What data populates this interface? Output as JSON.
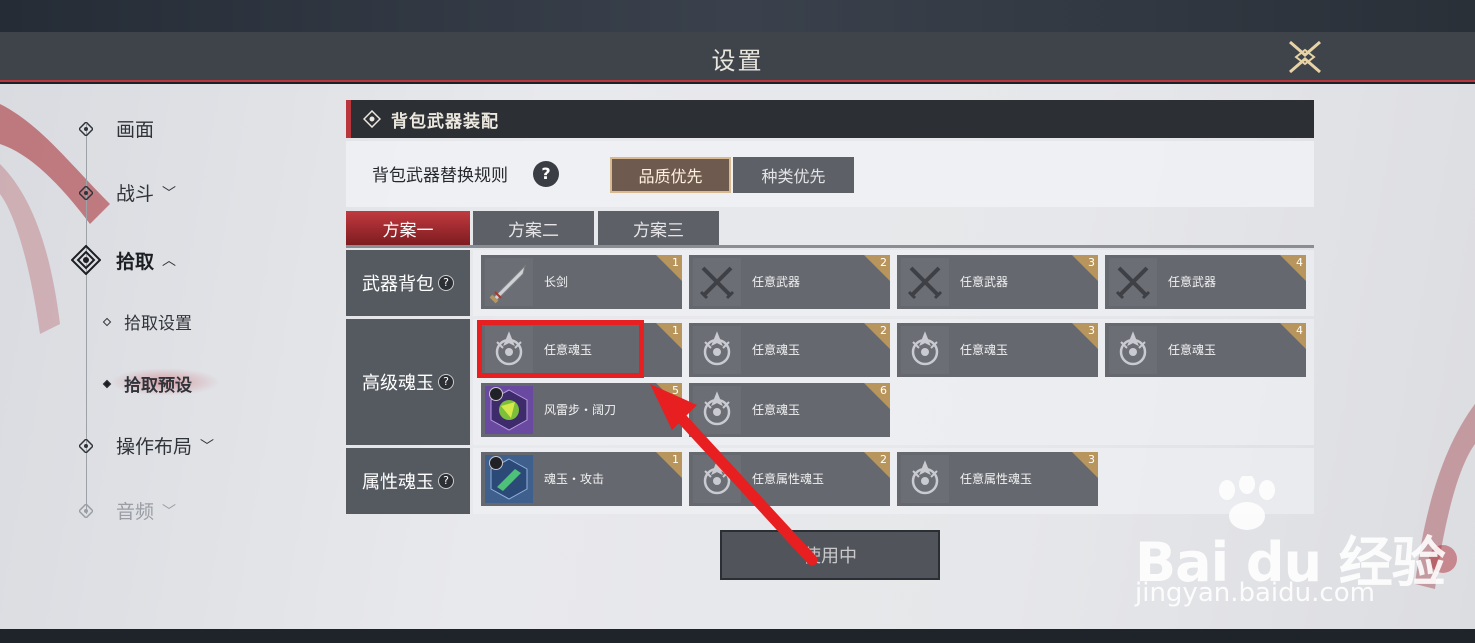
{
  "header": {
    "title": "设置"
  },
  "nav": {
    "items": [
      {
        "label": "画面",
        "chevron": ""
      },
      {
        "label": "战斗",
        "chevron": "﹀"
      },
      {
        "label": "拾取",
        "chevron": "︿"
      },
      {
        "label": "操作布局",
        "chevron": "﹀"
      },
      {
        "label": "音频",
        "chevron": "﹀"
      }
    ],
    "sub_items": [
      {
        "label": "拾取设置"
      },
      {
        "label": "拾取预设"
      }
    ]
  },
  "section": {
    "title": "背包武器装配"
  },
  "rule": {
    "label": "背包武器替换规则",
    "help": "?",
    "options": [
      "品质优先",
      "种类优先"
    ],
    "selected": "品质优先"
  },
  "tabs": [
    "方案一",
    "方案二",
    "方案三"
  ],
  "rows": {
    "weapon": {
      "label": "武器背包",
      "slots": [
        {
          "name": "长剑",
          "num": "1",
          "icon": "sword-icon"
        },
        {
          "name": "任意武器",
          "num": "2",
          "icon": "crossed-swords-icon"
        },
        {
          "name": "任意武器",
          "num": "3",
          "icon": "crossed-swords-icon"
        },
        {
          "name": "任意武器",
          "num": "4",
          "icon": "crossed-swords-icon"
        }
      ]
    },
    "soul": {
      "label": "高级魂玉",
      "slots": [
        {
          "name": "任意魂玉",
          "num": "1",
          "icon": "soul-jade-icon"
        },
        {
          "name": "任意魂玉",
          "num": "2",
          "icon": "soul-jade-icon"
        },
        {
          "name": "任意魂玉",
          "num": "3",
          "icon": "soul-jade-icon"
        },
        {
          "name": "任意魂玉",
          "num": "4",
          "icon": "soul-jade-icon"
        },
        {
          "name": "风雷步・阔刀",
          "num": "5",
          "icon": "wind-thunder-icon"
        },
        {
          "name": "任意魂玉",
          "num": "6",
          "icon": "soul-jade-icon"
        }
      ]
    },
    "attr": {
      "label": "属性魂玉",
      "slots": [
        {
          "name": "魂玉・攻击",
          "num": "1",
          "icon": "attack-jade-icon"
        },
        {
          "name": "任意属性魂玉",
          "num": "2",
          "icon": "soul-jade-icon"
        },
        {
          "name": "任意属性魂玉",
          "num": "3",
          "icon": "soul-jade-icon"
        }
      ]
    }
  },
  "use_button": {
    "label": "使用中"
  },
  "watermark": {
    "brand": "Bai du 经验",
    "url": "jingyan.baidu.com"
  },
  "colors": {
    "accent_red": "#b8363c",
    "gold": "#b8955c",
    "annotation_red": "#e81f20"
  }
}
